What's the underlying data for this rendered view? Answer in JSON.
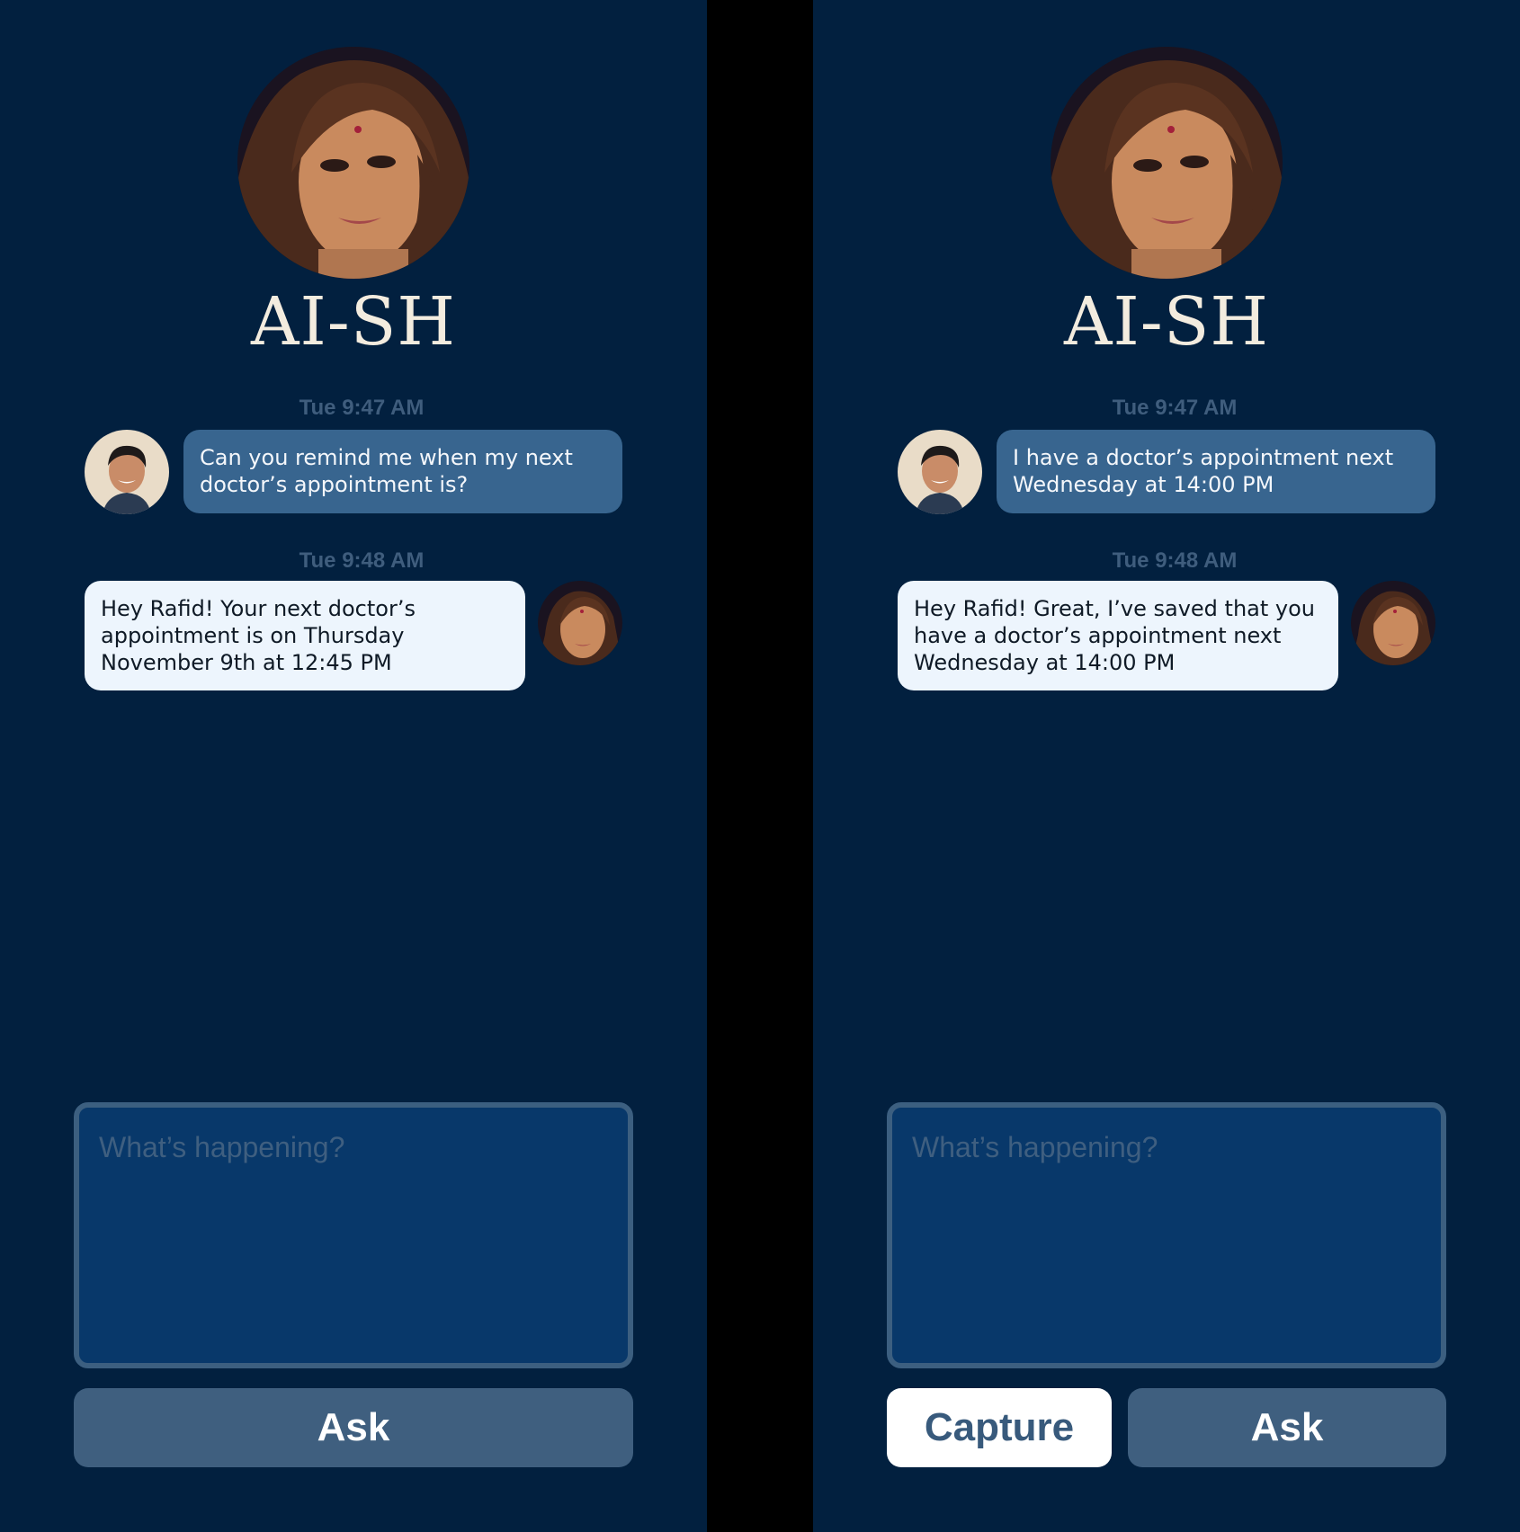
{
  "colors": {
    "background": "#02203f",
    "divider": "#000000",
    "title": "#f3ecdf",
    "timestamp": "#3f5d7d",
    "user_bubble": "#38658f",
    "bot_bubble": "#edf5fd",
    "composer_fill": "#08386a",
    "composer_border": "#3c5f80",
    "ask_button": "#3f5f7f",
    "capture_button": "#ffffff"
  },
  "screens": [
    {
      "title": "AI-SH",
      "messages": [
        {
          "timestamp": "Tue 9:47 AM",
          "sender": "user",
          "text": "Can you remind me when my next doctor’s appointment is?"
        },
        {
          "timestamp": "Tue 9:48 AM",
          "sender": "assistant",
          "text": "Hey Rafid! Your next doctor’s appointment is on Thursday November 9th at 12:45 PM"
        }
      ],
      "composer_placeholder": "What’s happening?",
      "buttons": {
        "ask": "Ask"
      }
    },
    {
      "title": "AI-SH",
      "messages": [
        {
          "timestamp": "Tue 9:47 AM",
          "sender": "user",
          "text": "I have a doctor’s appointment next Wednesday at 14:00 PM"
        },
        {
          "timestamp": "Tue 9:48 AM",
          "sender": "assistant",
          "text": "Hey Rafid! Great, I’ve saved that you have a doctor’s appointment next Wednesday at 14:00 PM"
        }
      ],
      "composer_placeholder": "What’s happening?",
      "buttons": {
        "capture": "Capture",
        "ask": "Ask"
      }
    }
  ]
}
